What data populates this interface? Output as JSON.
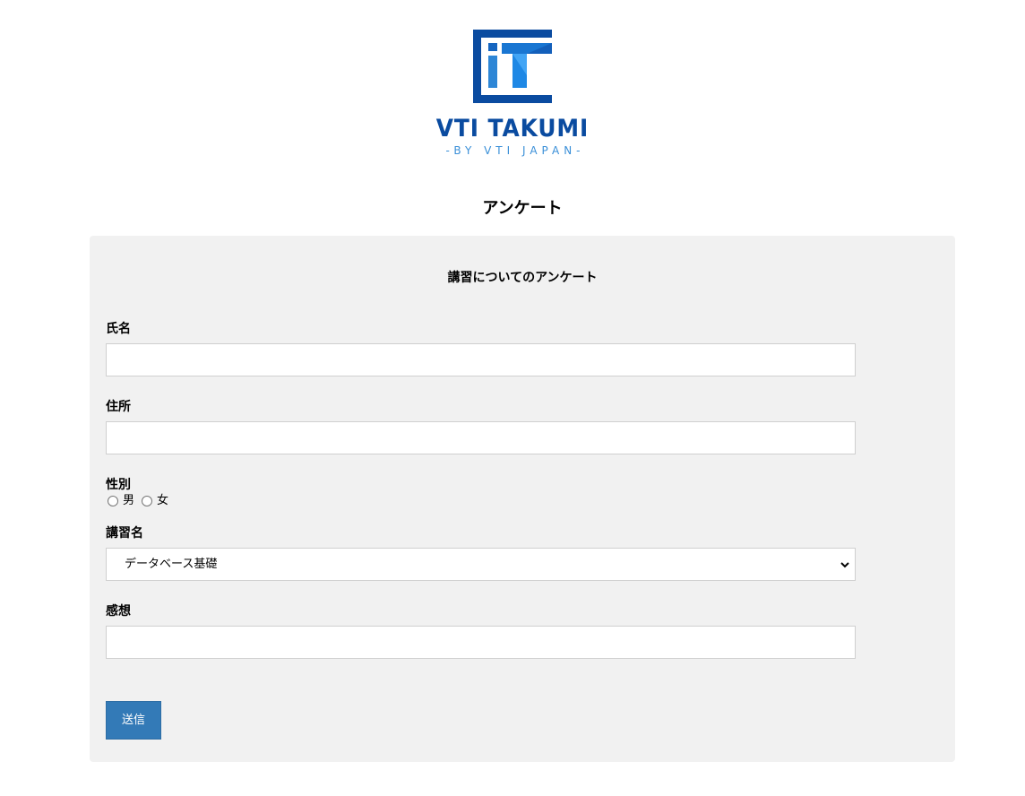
{
  "logo": {
    "brand": "VTI TAKUMI",
    "sub": "-BY VTI JAPAN-"
  },
  "page_title": "アンケート",
  "form": {
    "title": "講習についてのアンケート",
    "name_label": "氏名",
    "name_value": "",
    "address_label": "住所",
    "address_value": "",
    "gender_label": "性別",
    "gender_options": [
      "男",
      "女"
    ],
    "course_label": "講習名",
    "course_selected": "データベース基礎",
    "impression_label": "感想",
    "impression_value": "",
    "submit_label": "送信"
  },
  "colors": {
    "brand_blue": "#0a4ba0",
    "accent_blue": "#3a8fd8",
    "button_blue": "#337ab7",
    "card_bg": "#f1f1f1"
  }
}
